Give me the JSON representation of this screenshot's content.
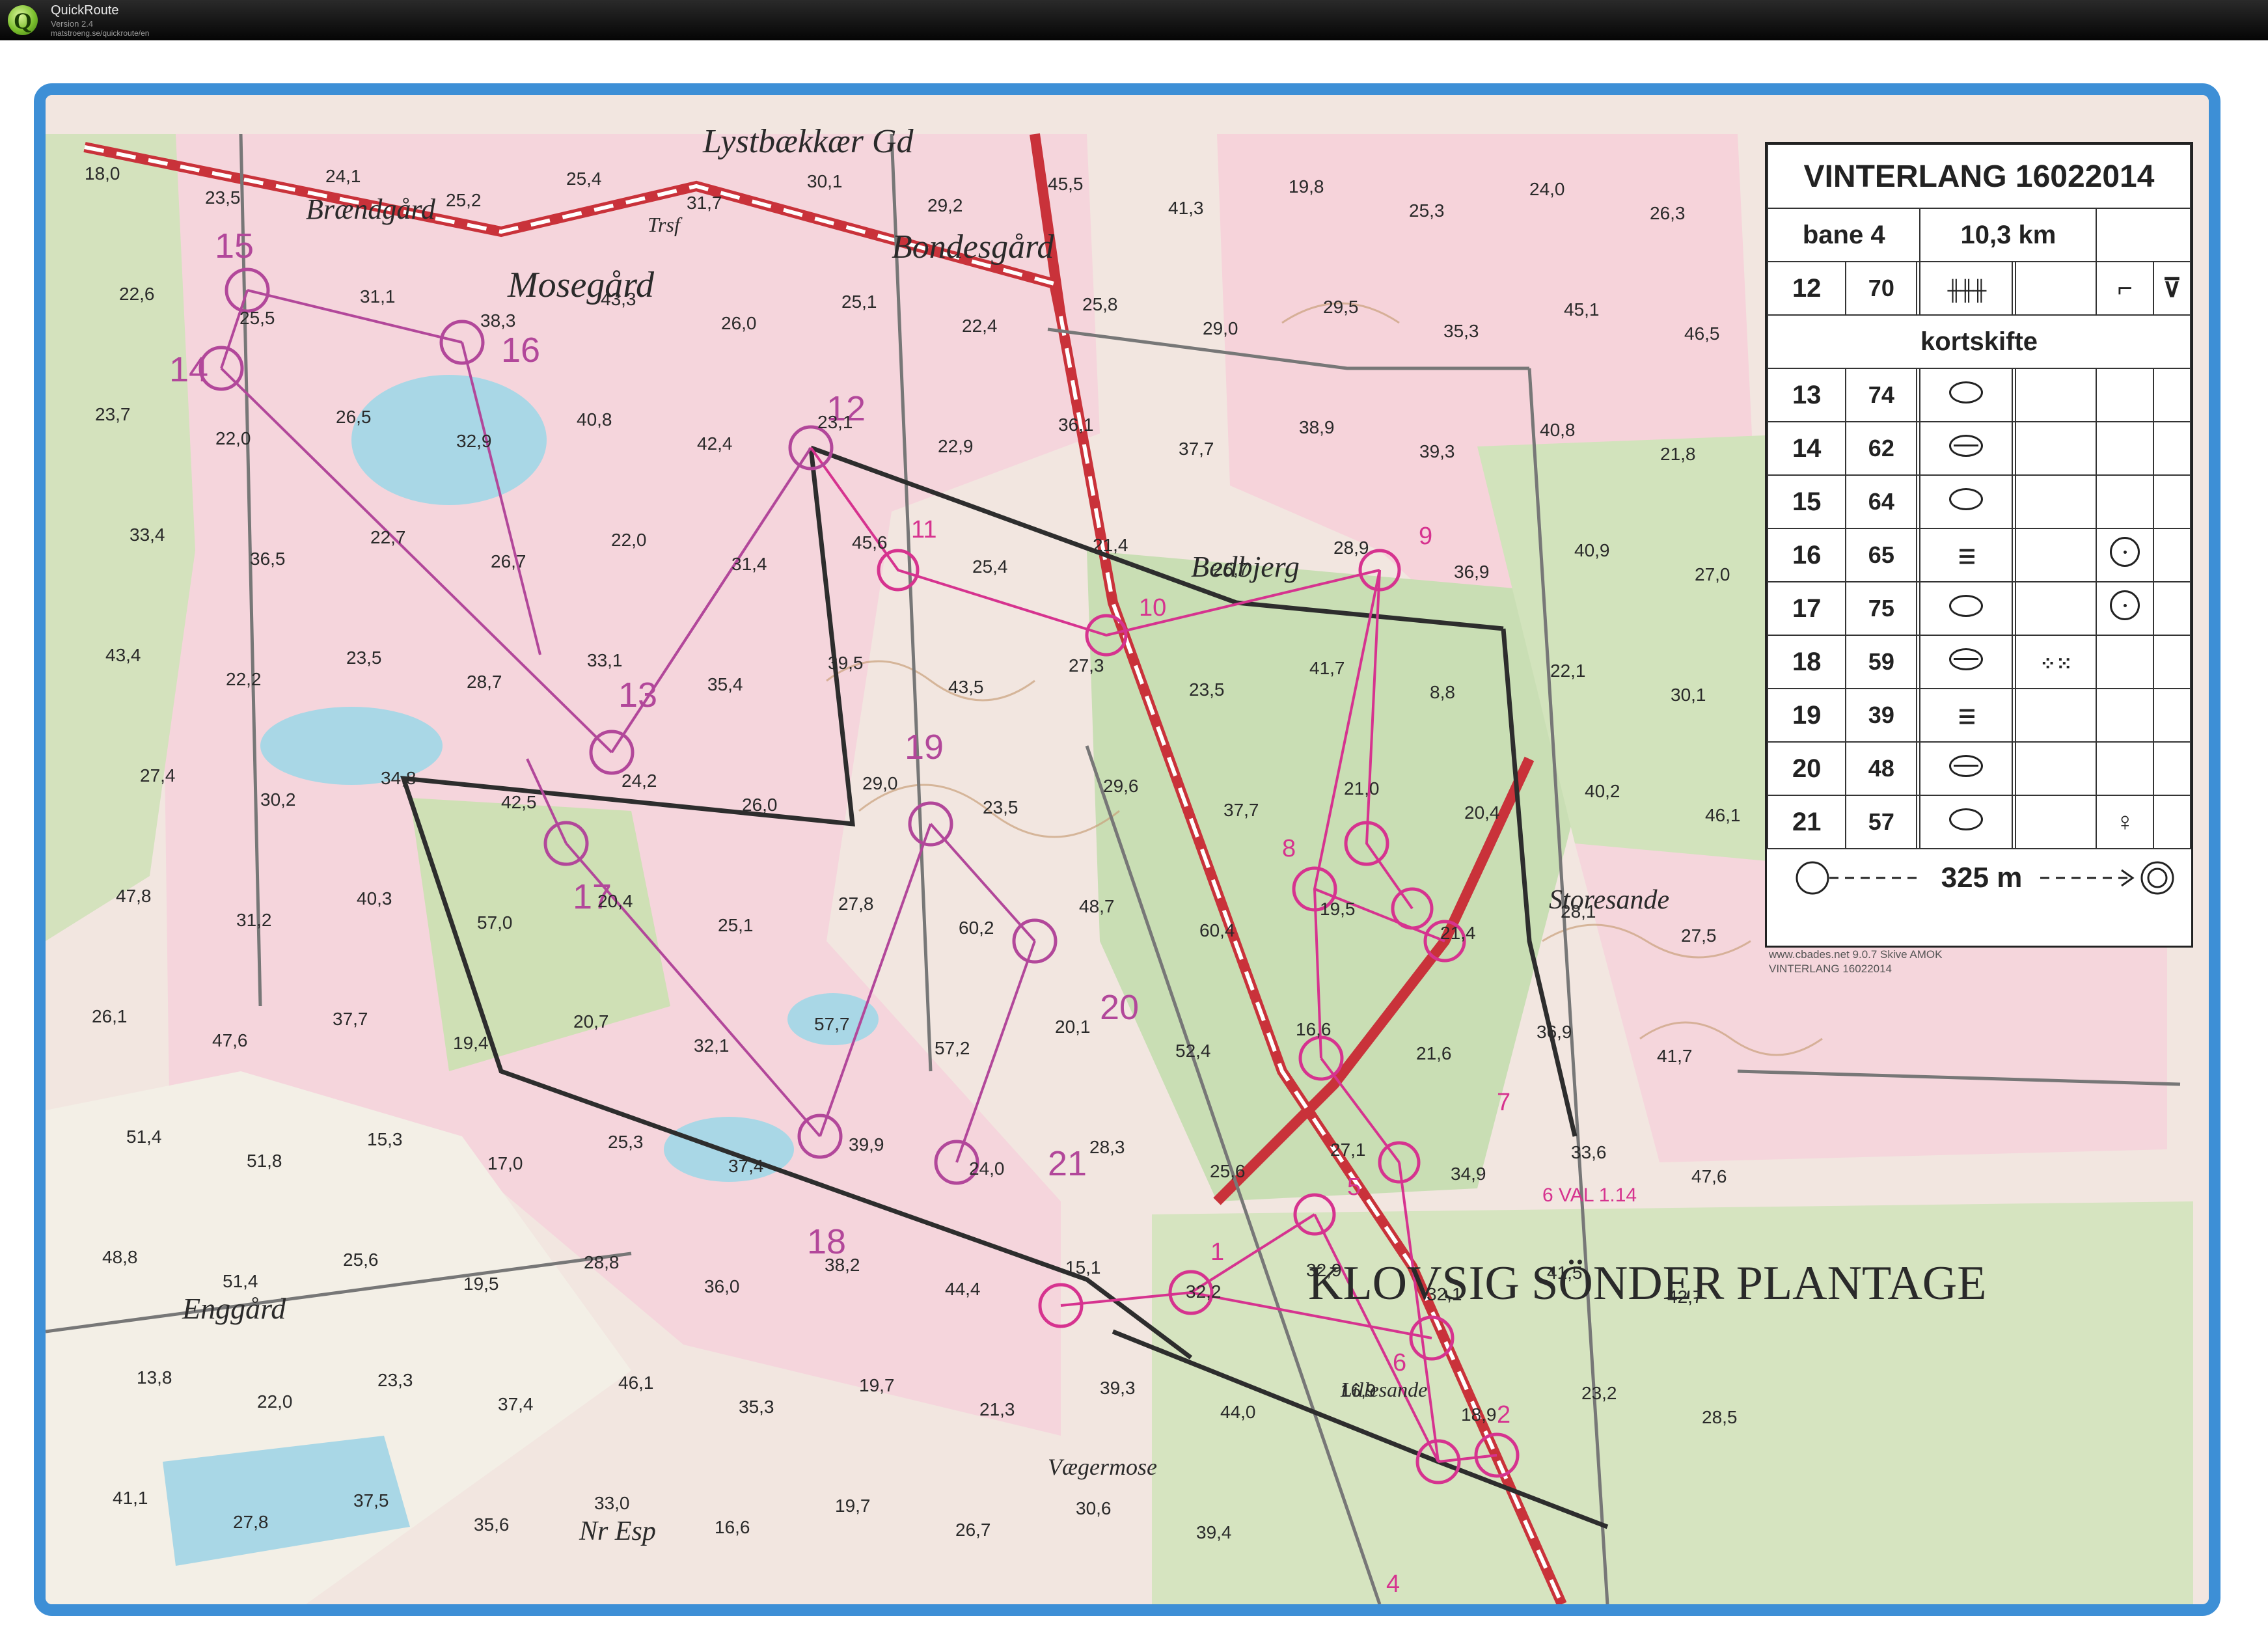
{
  "app": {
    "title": "QuickRoute",
    "version": "Version 2.4",
    "url": "matstroeng.se/quickroute/en"
  },
  "colors": {
    "frame": "#3d8fd6",
    "course": "#b2479a",
    "route": "#d6338f",
    "road": "#c9323a",
    "open_land": "#f4d6dc",
    "forest": "#cfe0b8",
    "water": "#a7d6e8"
  },
  "legend": {
    "title": "VINTERLANG 16022014",
    "course": "bane 4",
    "length": "10,3 km",
    "start_row": {
      "num": "12",
      "code": "70"
    },
    "section_label": "kortskifte",
    "controls": [
      {
        "num": "13",
        "code": "74",
        "symbol": "ellipse-icon",
        "extra": ""
      },
      {
        "num": "14",
        "code": "62",
        "symbol": "crossed-ellipse-icon",
        "extra": ""
      },
      {
        "num": "15",
        "code": "64",
        "symbol": "ellipse-icon",
        "extra": ""
      },
      {
        "num": "16",
        "code": "65",
        "symbol": "marsh-icon",
        "extra": "circle-dot-icon"
      },
      {
        "num": "17",
        "code": "75",
        "symbol": "ellipse-icon",
        "extra": "circle-dot-icon"
      },
      {
        "num": "18",
        "code": "59",
        "symbol": "crossed-ellipse-icon",
        "extra": "stony-ground-icon"
      },
      {
        "num": "19",
        "code": "39",
        "symbol": "marsh-icon",
        "extra": ""
      },
      {
        "num": "20",
        "code": "48",
        "symbol": "crossed-ellipse-icon",
        "extra": ""
      },
      {
        "num": "21",
        "code": "57",
        "symbol": "ellipse-icon",
        "extra": "circle-stem-icon"
      }
    ],
    "finish_distance": "325 m",
    "footer": [
      "www.cbades.net 9.0.7 Skive AMOK",
      "VINTERLANG 16022014"
    ]
  },
  "map": {
    "place_names": [
      {
        "id": "lystbaekkaer",
        "text": "Lystbækkær Gd"
      },
      {
        "id": "braendgard",
        "text": "Brændgård"
      },
      {
        "id": "trsf",
        "text": "Trsf"
      },
      {
        "id": "bondesgard",
        "text": "Bondesgård"
      },
      {
        "id": "mosegard",
        "text": "Mosegård"
      },
      {
        "id": "bedbjerg",
        "text": "Bedbjerg"
      },
      {
        "id": "storesande",
        "text": "Storesande"
      },
      {
        "id": "enggard",
        "text": "Enggård"
      },
      {
        "id": "lillesande",
        "text": "Lillesande"
      },
      {
        "id": "vaegermose",
        "text": "Vægermose"
      },
      {
        "id": "nresp",
        "text": "Nr Esp"
      },
      {
        "id": "klovsig",
        "text": "KLOVSIG SÖNDER PLANTAGE"
      }
    ],
    "control_numbers": [
      "12",
      "13",
      "14",
      "15",
      "16",
      "17",
      "18",
      "19",
      "20",
      "21"
    ],
    "route_notes": [
      "1",
      "2",
      "4",
      "5",
      "6",
      "7",
      "8",
      "9",
      "10",
      "11",
      "6 VAL 1.14"
    ],
    "heights": [
      "18,0",
      "23,5",
      "24,1",
      "25,2",
      "25,4",
      "31,7",
      "30,1",
      "29,2",
      "45,5",
      "41,3",
      "19,8",
      "25,3",
      "24,0",
      "26,3",
      "22,6",
      "25,5",
      "31,1",
      "38,3",
      "43,3",
      "26,0",
      "25,1",
      "22,4",
      "25,8",
      "29,0",
      "29,5",
      "35,3",
      "45,1",
      "46,5",
      "23,7",
      "22,0",
      "26,5",
      "32,9",
      "40,8",
      "42,4",
      "23,1",
      "22,9",
      "36,1",
      "37,7",
      "38,9",
      "39,3",
      "40,8",
      "21,8",
      "33,4",
      "36,5",
      "22,7",
      "26,7",
      "22,0",
      "31,4",
      "45,6",
      "25,4",
      "21,4",
      "26,7",
      "28,9",
      "36,9",
      "40,9",
      "27,0",
      "43,4",
      "22,2",
      "23,5",
      "28,7",
      "33,1",
      "35,4",
      "39,5",
      "43,5",
      "27,3",
      "23,5",
      "41,7",
      "8,8",
      "22,1",
      "30,1",
      "27,4",
      "30,2",
      "34,8",
      "42,5",
      "24,2",
      "26,0",
      "29,0",
      "23,5",
      "29,6",
      "37,7",
      "21,0",
      "20,4",
      "40,2",
      "46,1",
      "47,8",
      "31,2",
      "40,3",
      "57,0",
      "20,4",
      "25,1",
      "27,8",
      "60,2",
      "48,7",
      "60,4",
      "19,5",
      "21,4",
      "28,1",
      "27,5",
      "26,1",
      "47,6",
      "37,7",
      "19,4",
      "20,7",
      "32,1",
      "57,7",
      "57,2",
      "20,1",
      "52,4",
      "16,6",
      "21,6",
      "36,9",
      "41,7",
      "51,4",
      "51,8",
      "15,3",
      "17,0",
      "25,3",
      "37,4",
      "39,9",
      "24,0",
      "28,3",
      "25,6",
      "27,1",
      "34,9",
      "33,6",
      "47,6",
      "48,8",
      "51,4",
      "25,6",
      "19,5",
      "28,8",
      "36,0",
      "38,2",
      "44,4",
      "15,1",
      "32,2",
      "32,9",
      "32,1",
      "41,5",
      "42,7",
      "13,8",
      "22,0",
      "23,3",
      "37,4",
      "46,1",
      "35,3",
      "19,7",
      "21,3",
      "39,3",
      "44,0",
      "16,9",
      "18,9",
      "23,2",
      "28,5",
      "41,1",
      "27,8",
      "37,5",
      "35,6",
      "33,0",
      "16,6",
      "19,7",
      "26,7",
      "30,6",
      "39,4"
    ]
  }
}
